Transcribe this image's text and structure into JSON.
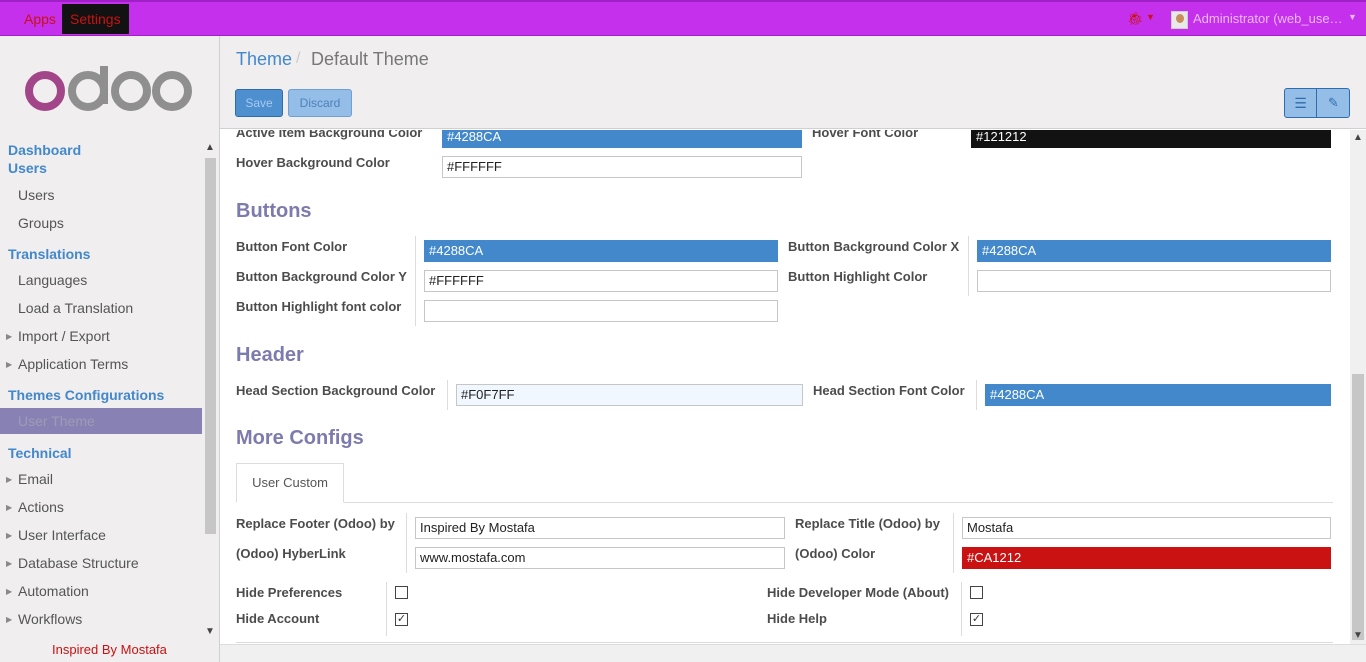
{
  "topbar": {
    "apps": "Apps",
    "settings": "Settings",
    "user": "Administrator (web_use…",
    "colors": {
      "bar": "#c530ec",
      "text": "#c81212"
    }
  },
  "sidebar": {
    "logo_text": "odoo",
    "sections": [
      {
        "label": "Dashboard"
      },
      {
        "label": "Users",
        "items": [
          "Users",
          "Groups"
        ]
      },
      {
        "label": "Translations",
        "items": [
          "Languages",
          "Load a Translation",
          "Import / Export",
          "Application Terms"
        ]
      },
      {
        "label": "Themes Configurations",
        "items": [
          "User Theme"
        ]
      },
      {
        "label": "Technical",
        "items": [
          "Email",
          "Actions",
          "User Interface",
          "Database Structure",
          "Automation",
          "Workflows"
        ]
      }
    ],
    "footer": "Inspired By Mostafa"
  },
  "breadcrumb": {
    "parent": "Theme",
    "separator": "/",
    "current": "Default Theme"
  },
  "buttons": {
    "save": "Save",
    "discard": "Discard"
  },
  "form": {
    "top": {
      "active_item_bg_label": "Active Item Background Color",
      "active_item_bg_value": "#4288CA",
      "hover_font_label": "Hover Font Color",
      "hover_font_value": "#121212",
      "hover_bg_label": "Hover Background Color",
      "hover_bg_value": "#FFFFFF"
    },
    "buttons_section": {
      "title": "Buttons",
      "font_color_label": "Button Font Color",
      "font_color_value": "#4288CA",
      "bg_x_label": "Button Background Color X",
      "bg_x_value": "#4288CA",
      "bg_y_label": "Button Background Color Y",
      "bg_y_value": "#FFFFFF",
      "highlight_label": "Button Highlight Color",
      "highlight_value": "",
      "highlight_font_label": "Button Highlight font color",
      "highlight_font_value": ""
    },
    "header_section": {
      "title": "Header",
      "bg_label": "Head Section Background Color",
      "bg_value": "#F0F7FF",
      "font_label": "Head Section Font Color",
      "font_value": "#4288CA"
    },
    "more_section": {
      "title": "More Configs",
      "tab": "User Custom",
      "footer_label": "Replace Footer (Odoo) by",
      "footer_value": "Inspired By Mostafa",
      "title_label": "Replace Title (Odoo) by",
      "title_value": "Mostafa",
      "link_label": "(Odoo) HyberLink",
      "link_value": "www.mostafa.com",
      "color_label": "(Odoo) Color",
      "color_value": "#CA1212",
      "hide_prefs_label": "Hide Preferences",
      "hide_prefs": false,
      "hide_dev_label": "Hide Developer Mode (About)",
      "hide_dev": false,
      "hide_account_label": "Hide Account",
      "hide_account": true,
      "hide_help_label": "Hide Help",
      "hide_help": true
    }
  }
}
